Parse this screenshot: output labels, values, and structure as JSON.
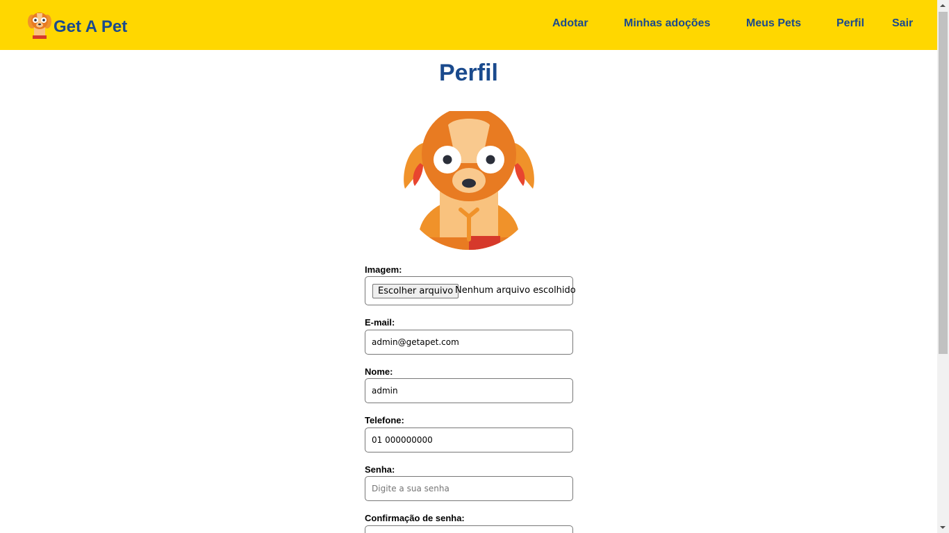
{
  "app": {
    "brand_name": "Get A Pet",
    "logo_icon": "dog-logo-icon"
  },
  "nav": {
    "items": [
      {
        "label": "Adotar"
      },
      {
        "label": "Minhas adoções"
      },
      {
        "label": "Meus Pets"
      },
      {
        "label": "Perfil"
      },
      {
        "label": "Sair"
      }
    ]
  },
  "page": {
    "title": "Perfil",
    "avatar_icon": "dog-avatar-icon"
  },
  "form": {
    "image": {
      "label": "Imagem:",
      "button": "Escolher arquivo",
      "status": "Nenhum arquivo escolhido"
    },
    "email": {
      "label": "E-mail:",
      "value": "admin@getapet.com"
    },
    "name": {
      "label": "Nome:",
      "value": "admin"
    },
    "phone": {
      "label": "Telefone:",
      "value": "01 000000000"
    },
    "password": {
      "label": "Senha:",
      "placeholder": "Digite a sua senha"
    },
    "confirm": {
      "label": "Confirmação de senha:"
    }
  },
  "colors": {
    "navbar_bg": "#FFD700",
    "brand_text": "#1a4a8d"
  }
}
